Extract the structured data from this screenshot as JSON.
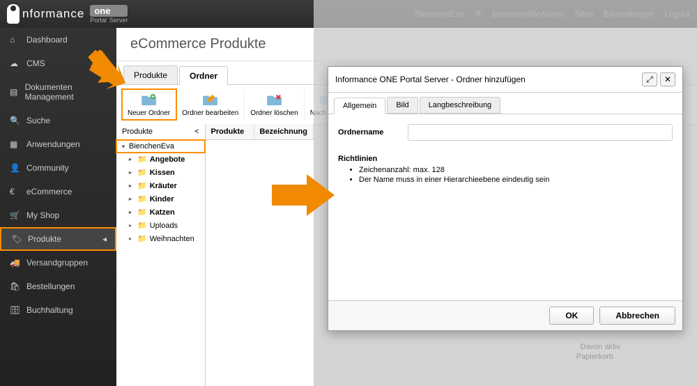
{
  "header": {
    "logo_text": "nformance",
    "logo_one": "one",
    "logo_portal": "Portal",
    "logo_server": "Server",
    "user": "BienchenEva",
    "siteadmin": "bienchenSiteAdmin",
    "sites": "Sites",
    "settings": "Einstellungen",
    "logout": "Logout"
  },
  "sidebar": {
    "items": [
      {
        "label": "Dashboard",
        "icon": "home"
      },
      {
        "label": "CMS",
        "icon": "cloud"
      },
      {
        "label": "Dokumenten Management",
        "icon": "doc"
      },
      {
        "label": "Suche",
        "icon": "search"
      },
      {
        "label": "Anwendungen",
        "icon": "grid"
      },
      {
        "label": "Community",
        "icon": "user"
      },
      {
        "label": "eCommerce",
        "icon": "euro"
      },
      {
        "label": "My Shop",
        "icon": "cart"
      },
      {
        "label": "Produkte",
        "icon": "tag",
        "active": true
      },
      {
        "label": "Versandgruppen",
        "icon": "truck"
      },
      {
        "label": "Bestellungen",
        "icon": "cart2"
      },
      {
        "label": "Buchhaltung",
        "icon": "calc"
      }
    ]
  },
  "page": {
    "title": "eCommerce Produkte",
    "tabs": {
      "products": "Produkte",
      "folders": "Ordner"
    },
    "toolbar": {
      "new_folder": "Neuer Ordner",
      "edit_folder": "Ordner bearbeiten",
      "delete_folder": "Ordner löschen",
      "move_up": "Nach oben"
    },
    "tree": {
      "header": "Produkte",
      "root": "BienchenEva",
      "items": [
        {
          "label": "Angebote",
          "bold": true
        },
        {
          "label": "Kissen",
          "bold": true
        },
        {
          "label": "Kräuter",
          "bold": true
        },
        {
          "label": "Kinder",
          "bold": true
        },
        {
          "label": "Katzen",
          "bold": true
        },
        {
          "label": "Uploads",
          "bold": false
        },
        {
          "label": "Weihnachten",
          "bold": false
        }
      ]
    },
    "grid": {
      "col1": "Produkte",
      "col2": "Bezeichnung"
    }
  },
  "dialog": {
    "title": "Informance ONE Portal Server - Ordner hinzufügen",
    "tabs": {
      "general": "Allgemein",
      "image": "Bild",
      "longdesc": "Langbeschreibung"
    },
    "field_label": "Ordnername",
    "guidelines_title": "Richtlinien",
    "guidelines": [
      "Zeichenanzahl: max. 128",
      "Der Name muss in einer Hierarchieebene eindeutig sein"
    ],
    "ok": "OK",
    "cancel": "Abbrechen"
  },
  "faded": {
    "davon": "Davon aktiv",
    "trash": "Papierkorb"
  }
}
